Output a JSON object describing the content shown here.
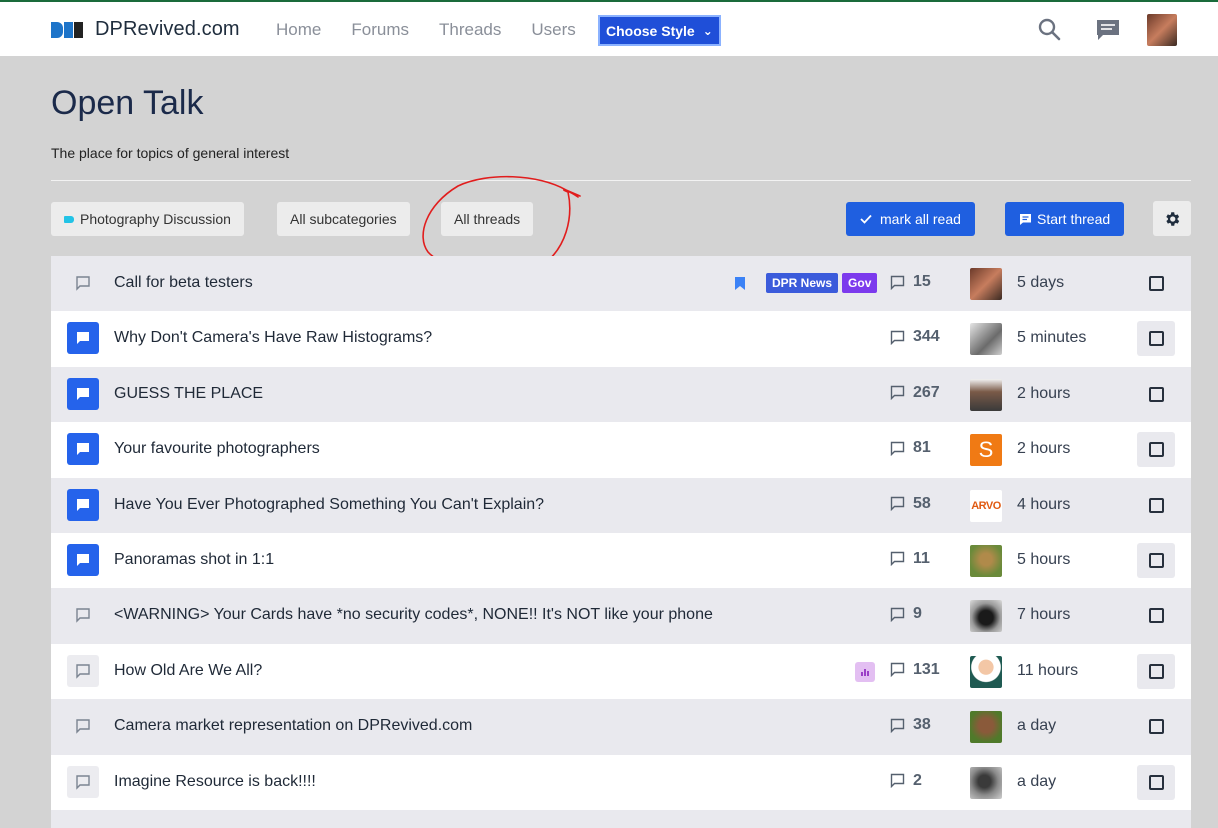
{
  "header": {
    "site_name": "DPRevived.com",
    "logo_mark": "DPR",
    "nav": [
      "Home",
      "Forums",
      "Threads",
      "Users"
    ],
    "style_button": "Choose Style",
    "icons": [
      "search-icon",
      "messages-icon",
      "avatar"
    ]
  },
  "forum": {
    "title": "Open Talk",
    "description": "The place for topics of general interest"
  },
  "filters": {
    "category": "Photography Discussion",
    "subcategories": "All subcategories",
    "threads": "All threads",
    "mark_read": "mark all read",
    "start_thread": "Start thread"
  },
  "colors": {
    "accent": "#2563eb",
    "tag_dpr_news": "#3b5bdb",
    "tag_gov": "#7c3aed",
    "annotation": "#e11d1d"
  },
  "threads": [
    {
      "title": "Call for beta testers",
      "unread": false,
      "replies": "15",
      "time": "5 days",
      "tags": [
        "DPR News",
        "Gov"
      ],
      "bookmarked": true,
      "poll": false
    },
    {
      "title": "Why Don't Camera's Have Raw Histograms?",
      "unread": true,
      "replies": "344",
      "time": "5 minutes",
      "tags": [],
      "bookmarked": false,
      "poll": false
    },
    {
      "title": "GUESS THE PLACE",
      "unread": true,
      "replies": "267",
      "time": "2 hours",
      "tags": [],
      "bookmarked": false,
      "poll": false
    },
    {
      "title": "Your favourite photographers",
      "unread": true,
      "replies": "81",
      "time": "2 hours",
      "tags": [],
      "bookmarked": false,
      "poll": false,
      "avatar_letter": "S"
    },
    {
      "title": "Have You Ever Photographed Something You Can't Explain?",
      "unread": true,
      "replies": "58",
      "time": "4 hours",
      "tags": [],
      "bookmarked": false,
      "poll": false,
      "avatar_letter": "ARVO"
    },
    {
      "title": "Panoramas shot in 1:1",
      "unread": true,
      "replies": "11",
      "time": "5 hours",
      "tags": [],
      "bookmarked": false,
      "poll": false
    },
    {
      "title": "<WARNING> Your Cards have *no security codes*, NONE!! It's NOT like your phone",
      "unread": false,
      "replies": "9",
      "time": "7 hours",
      "tags": [],
      "bookmarked": false,
      "poll": false
    },
    {
      "title": "How Old Are We All?",
      "unread": false,
      "replies": "131",
      "time": "11 hours",
      "tags": [],
      "bookmarked": false,
      "poll": true
    },
    {
      "title": "Camera market representation on DPRevived.com",
      "unread": false,
      "replies": "38",
      "time": "a day",
      "tags": [],
      "bookmarked": false,
      "poll": false
    },
    {
      "title": "Imagine Resource is back!!!!",
      "unread": false,
      "replies": "2",
      "time": "a day",
      "tags": [],
      "bookmarked": false,
      "poll": false
    }
  ]
}
